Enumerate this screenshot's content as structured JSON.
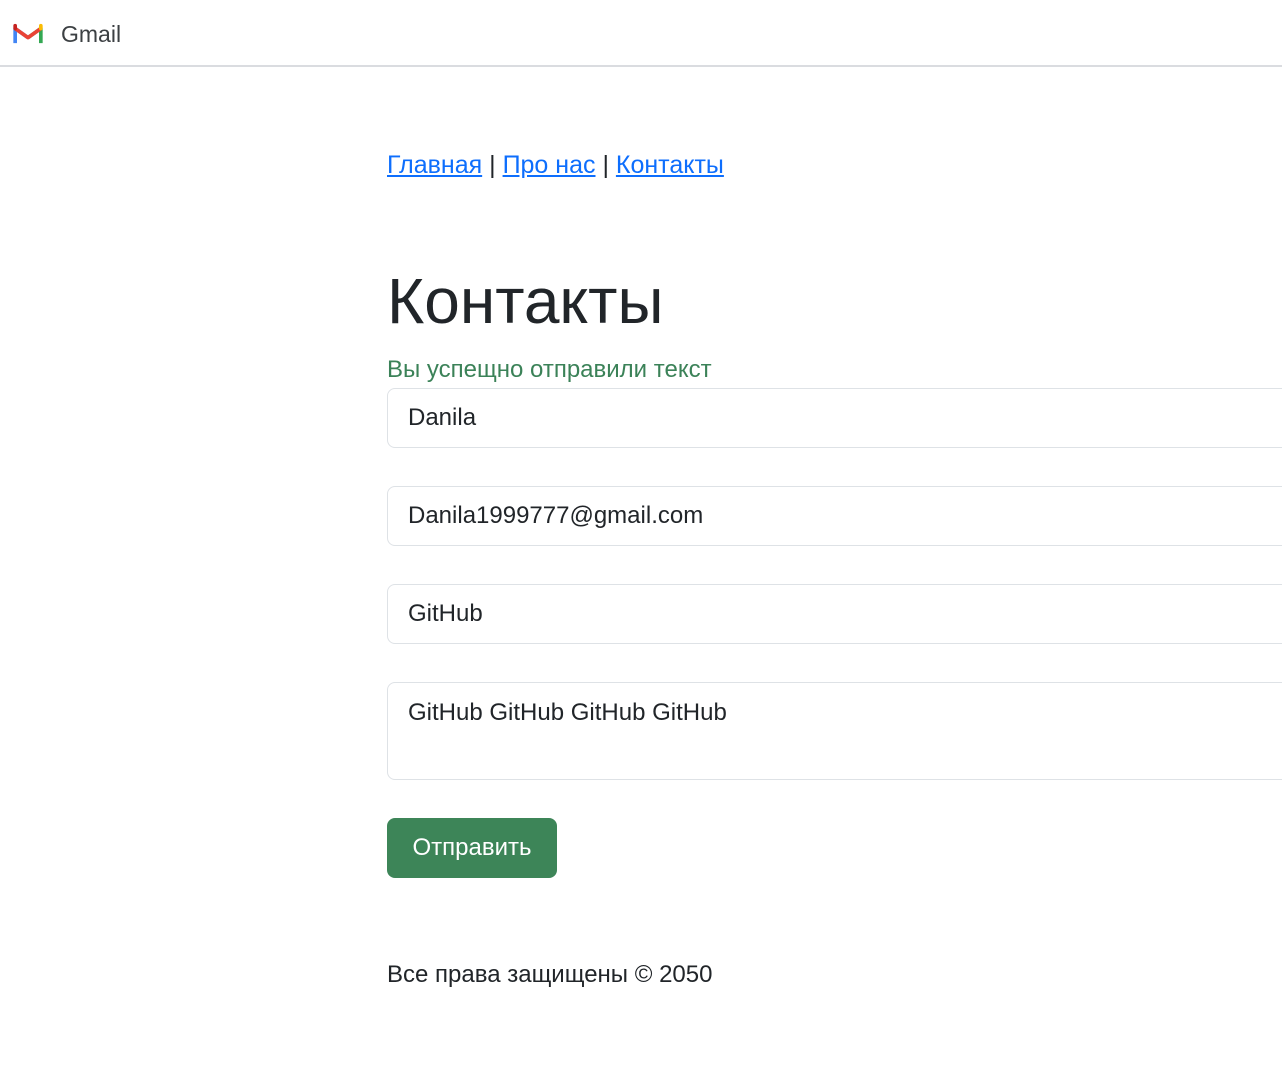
{
  "app": {
    "title": "Gmail",
    "logo_icon": "gmail-logo-icon"
  },
  "nav": {
    "home": "Главная",
    "about": "Про нас",
    "contacts": "Контакты",
    "separator": "|"
  },
  "page": {
    "title": "Контакты",
    "success_message": "Вы успещно отправили текст"
  },
  "form": {
    "name_value": "Danila",
    "email_value": "Danila1999777@gmail.com",
    "subject_value": "GitHub",
    "message_value": "GitHub GitHub GitHub GitHub",
    "submit_label": "Отправить"
  },
  "footer": {
    "text": "Все права защищены © 2050"
  },
  "colors": {
    "link": "#0d6efd",
    "success_text": "#3b8258",
    "button_bg": "#3d8558",
    "text": "#212529",
    "border": "#dee2e6"
  }
}
